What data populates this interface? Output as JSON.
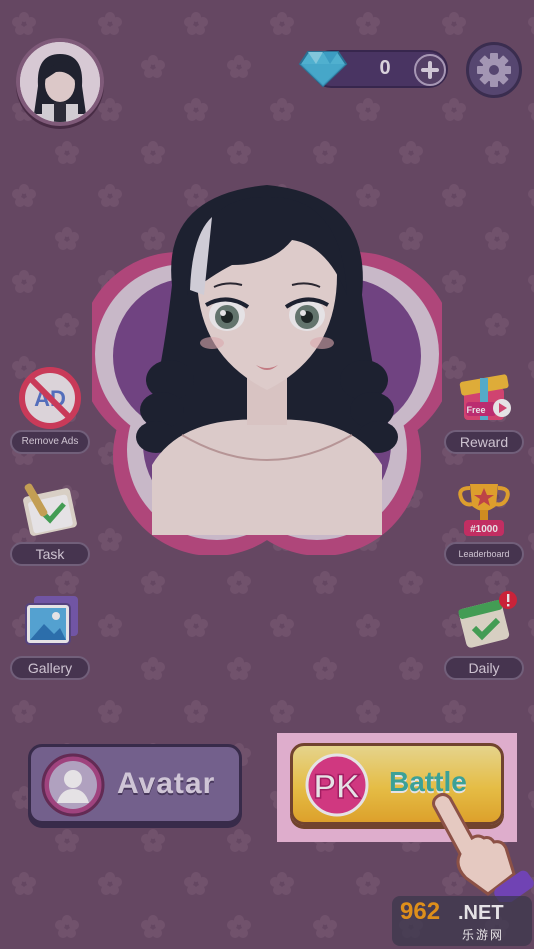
{
  "currency": {
    "value": "0",
    "icon": "diamond-icon"
  },
  "menu_left": [
    {
      "label": "Remove Ads",
      "icon": "no-ads-icon"
    },
    {
      "label": "Task",
      "icon": "task-checklist-icon"
    },
    {
      "label": "Gallery",
      "icon": "gallery-icon"
    }
  ],
  "menu_right": [
    {
      "label": "Reward",
      "icon": "gift-box-icon",
      "badge": "Free"
    },
    {
      "label": "Leaderboard",
      "icon": "trophy-icon",
      "badge": "#1000"
    },
    {
      "label": "Daily",
      "icon": "daily-calendar-icon"
    }
  ],
  "bottom": {
    "avatar_label": "Avatar",
    "battle_badge": "PK",
    "battle_label": "Battle"
  },
  "watermark": {
    "number": "962",
    "suffix": ".NET",
    "cn": "乐游网"
  },
  "colors": {
    "background": "#6e4f6a",
    "battle_button": "#ffd54a",
    "battle_text": "#3fb6a6",
    "highlight": "#f7c3e3"
  }
}
